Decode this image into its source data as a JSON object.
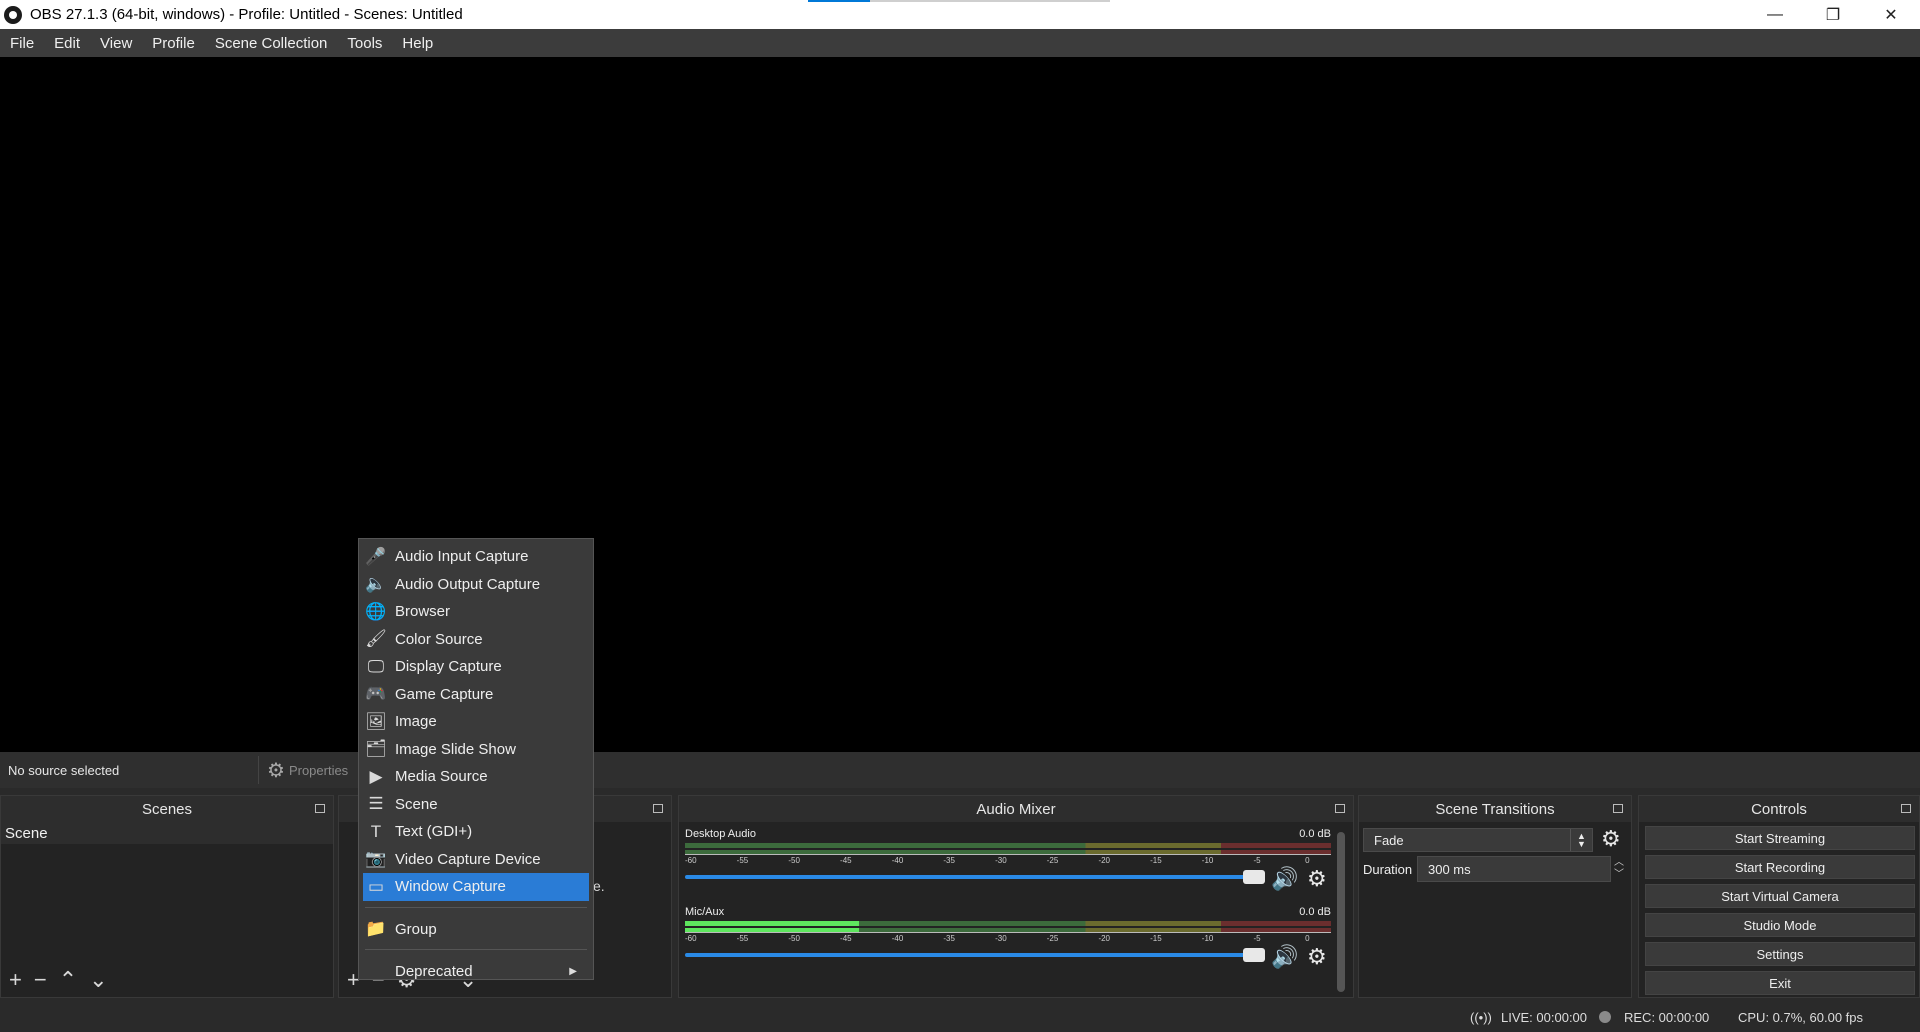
{
  "window": {
    "title": "OBS 27.1.3 (64-bit, windows) - Profile: Untitled - Scenes: Untitled",
    "minimize": "—",
    "maximize": "❐",
    "close": "✕"
  },
  "menubar": [
    "File",
    "Edit",
    "View",
    "Profile",
    "Scene Collection",
    "Tools",
    "Help"
  ],
  "source_toolbar": {
    "status": "No source selected",
    "properties_label": "Properties"
  },
  "scenes": {
    "title": "Scenes",
    "items": [
      "Scene"
    ]
  },
  "sources": {
    "hidden_text_fragment_1": ":",
    "hidden_text_fragment_2": "e."
  },
  "audio_mixer": {
    "title": "Audio Mixer",
    "tracks": [
      {
        "name": "Desktop Audio",
        "db": "0.0 dB",
        "level": 0.0
      },
      {
        "name": "Mic/Aux",
        "db": "0.0 dB",
        "level": 0.27
      }
    ],
    "scale": [
      "-60",
      "-55",
      "-50",
      "-45",
      "-40",
      "-35",
      "-30",
      "-25",
      "-20",
      "-15",
      "-10",
      "-5",
      "0"
    ]
  },
  "scene_transitions": {
    "title": "Scene Transitions",
    "transition": "Fade",
    "duration_label": "Duration",
    "duration_value": "300 ms"
  },
  "controls": {
    "title": "Controls",
    "buttons": [
      "Start Streaming",
      "Start Recording",
      "Start Virtual Camera",
      "Studio Mode",
      "Settings",
      "Exit"
    ]
  },
  "status_bar": {
    "live": "LIVE: 00:00:00",
    "rec": "REC: 00:00:00",
    "cpu": "CPU: 0.7%, 60.00 fps"
  },
  "context_menu": {
    "items": [
      {
        "label": "Audio Input Capture",
        "icon": "microphone-icon"
      },
      {
        "label": "Audio Output Capture",
        "icon": "speaker-icon"
      },
      {
        "label": "Browser",
        "icon": "globe-icon"
      },
      {
        "label": "Color Source",
        "icon": "brush-icon"
      },
      {
        "label": "Display Capture",
        "icon": "monitor-icon"
      },
      {
        "label": "Game Capture",
        "icon": "gamepad-icon"
      },
      {
        "label": "Image",
        "icon": "image-icon"
      },
      {
        "label": "Image Slide Show",
        "icon": "slideshow-icon"
      },
      {
        "label": "Media Source",
        "icon": "play-icon"
      },
      {
        "label": "Scene",
        "icon": "list-icon"
      },
      {
        "label": "Text (GDI+)",
        "icon": "text-icon"
      },
      {
        "label": "Video Capture Device",
        "icon": "camera-icon"
      },
      {
        "label": "Window Capture",
        "icon": "window-icon",
        "selected": true
      }
    ],
    "group": {
      "label": "Group",
      "icon": "folder-icon"
    },
    "deprecated": {
      "label": "Deprecated"
    }
  },
  "colors": {
    "selection": "#2a7cd6",
    "slider": "#2a8ae6",
    "meter_green": "#5ee65e"
  }
}
